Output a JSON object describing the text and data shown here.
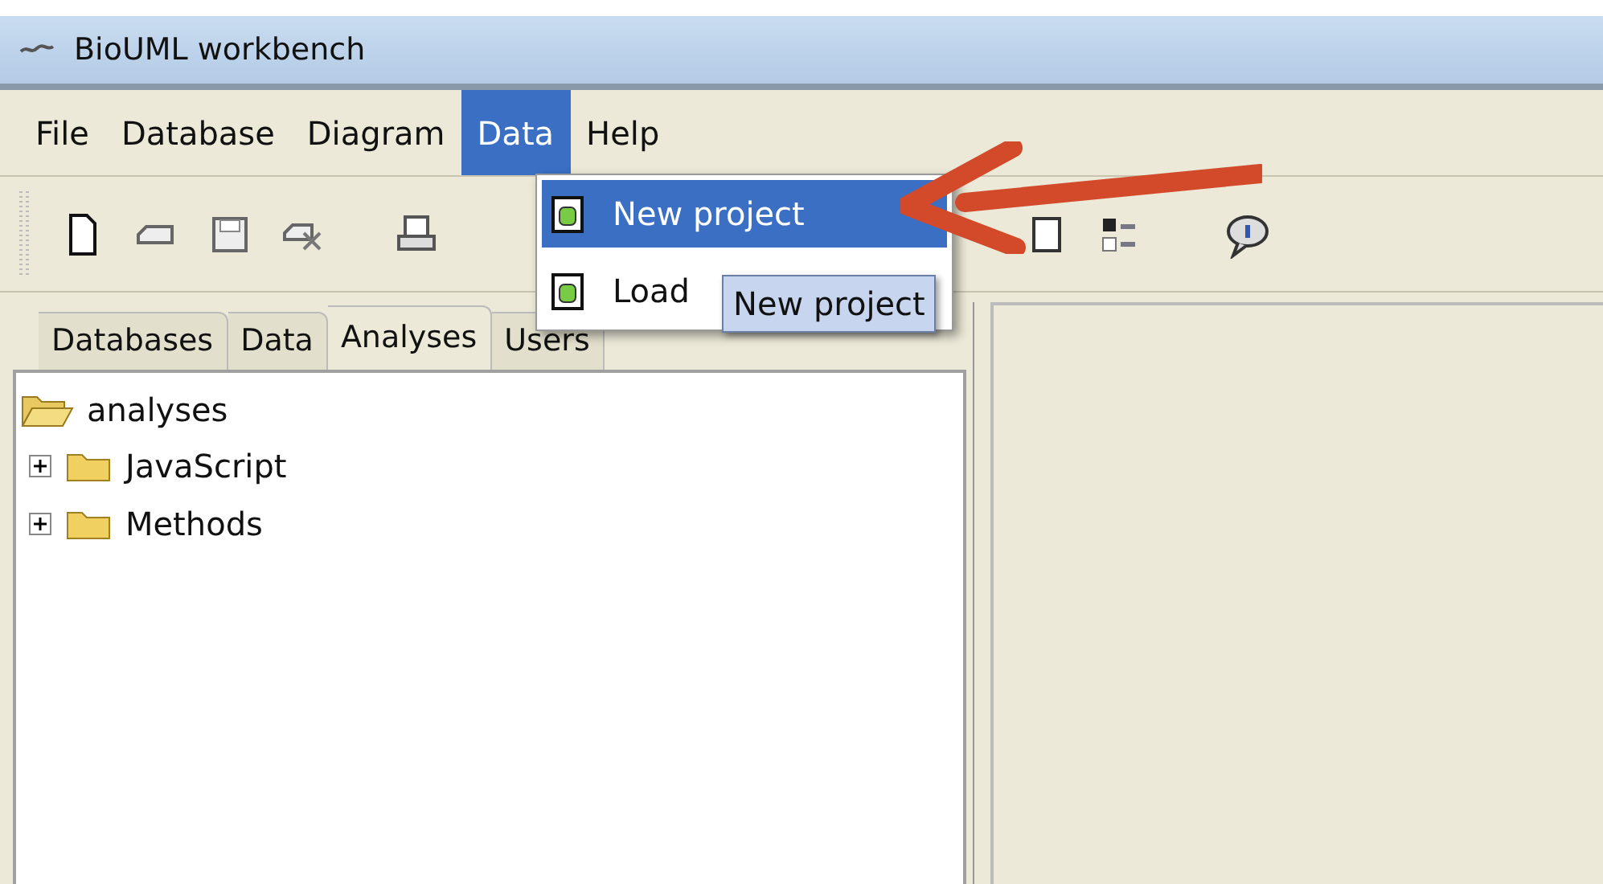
{
  "window": {
    "title": "BioUML workbench"
  },
  "menu_bar": [
    {
      "label": "File",
      "selected": false
    },
    {
      "label": "Database",
      "selected": false
    },
    {
      "label": "Diagram",
      "selected": false
    },
    {
      "label": "Data",
      "selected": true
    },
    {
      "label": "Help",
      "selected": false
    }
  ],
  "dropdown": {
    "items": [
      {
        "label": "New project",
        "selected": true
      },
      {
        "label": "Load",
        "selected": false
      }
    ],
    "tooltip": "New project"
  },
  "tabs": [
    {
      "label": "Databases",
      "selected": false
    },
    {
      "label": "Data",
      "selected": false
    },
    {
      "label": "Analyses",
      "selected": true
    },
    {
      "label": "Users",
      "selected": false
    }
  ],
  "tree": [
    {
      "label": "analyses",
      "expanded": true,
      "children": [
        {
          "label": "JavaScript",
          "expanded": false
        },
        {
          "label": "Methods",
          "expanded": false
        }
      ]
    }
  ]
}
